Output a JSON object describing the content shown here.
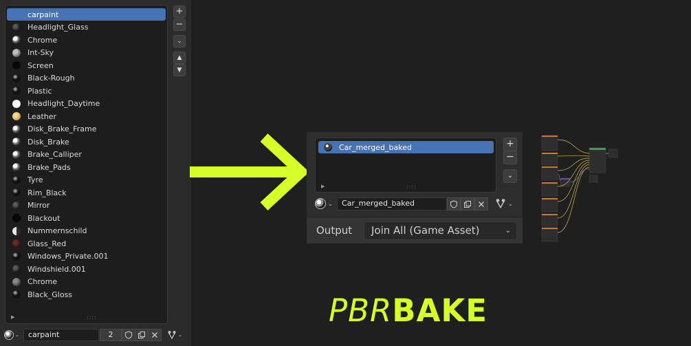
{
  "left_panel": {
    "materials": [
      {
        "label": "carpaint",
        "selected": true,
        "ball": "none"
      },
      {
        "label": "Headlight_Glass",
        "ball": "dark"
      },
      {
        "label": "Chrome",
        "ball": "chrome"
      },
      {
        "label": "Int-Sky",
        "ball": "grey"
      },
      {
        "label": "Screen",
        "ball": "black"
      },
      {
        "label": "Black-Rough",
        "ball": "black-shiny"
      },
      {
        "label": "Plastic",
        "ball": "black-shiny"
      },
      {
        "label": "Headlight_Daytime",
        "ball": "white"
      },
      {
        "label": "Leather",
        "ball": "tan"
      },
      {
        "label": "Disk_Brake_Frame",
        "ball": "chrome"
      },
      {
        "label": "Disk_Brake",
        "ball": "chrome"
      },
      {
        "label": "Brake_Calliper",
        "ball": "chrome"
      },
      {
        "label": "Brake_Pads",
        "ball": "chrome"
      },
      {
        "label": "Tyre",
        "ball": "black-shiny"
      },
      {
        "label": "Rim_Black",
        "ball": "black-shiny"
      },
      {
        "label": "Mirror",
        "ball": "dark"
      },
      {
        "label": "Blackout",
        "ball": "black"
      },
      {
        "label": "Nummernschild",
        "ball": "half"
      },
      {
        "label": "Glass_Red",
        "ball": "red"
      },
      {
        "label": "Windows_Private.001",
        "ball": "black-shiny"
      },
      {
        "label": "Windshield.001",
        "ball": "dark"
      },
      {
        "label": "Chrome",
        "ball": "grey-dark"
      },
      {
        "label": "Black_Gloss",
        "ball": "black-shiny"
      }
    ],
    "side_buttons": {
      "add": "+",
      "remove": "−",
      "menu": "⌄",
      "up": "▲",
      "down": "▼"
    },
    "list_grip": "::::",
    "list_expand": "▶",
    "bottom": {
      "material_name": "carpaint",
      "user_count": "2"
    }
  },
  "right_panel": {
    "item_label": "Car_merged_baked",
    "list_grip": "::::",
    "list_expand": "▶",
    "side_buttons": {
      "add": "+",
      "remove": "−",
      "menu": "⌄"
    },
    "material_name": "Car_merged_baked",
    "output_label": "Output",
    "output_value": "Join All (Game Asset)"
  },
  "logo": {
    "light": "PBR",
    "bold": "BAKE"
  },
  "colors": {
    "accent": "#d6ff2a",
    "selection": "#4772b3"
  }
}
